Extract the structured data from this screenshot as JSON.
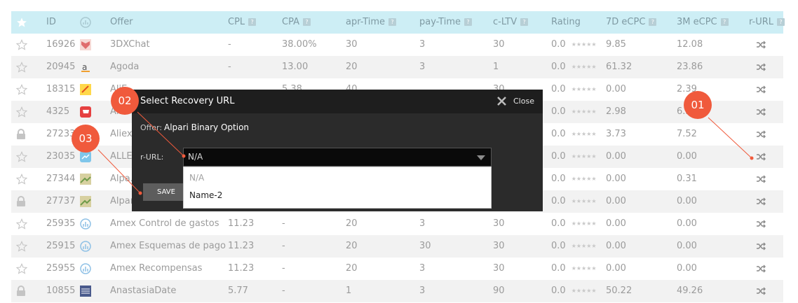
{
  "columns": {
    "id": "ID",
    "offer": "Offer",
    "cpl": "CPL",
    "cpa": "CPA",
    "apr_time": "apr-Time",
    "pay_time": "pay-Time",
    "c_ltv": "c-LTV",
    "rating": "Rating",
    "ecpc7d": "7D eCPC",
    "ecpc3m": "3M eCPC",
    "rurl": "r-URL",
    "help_glyph": "?"
  },
  "rating_stars": "★★★★★",
  "rows": [
    {
      "id": "16926",
      "offer": "3DXChat",
      "cpl": "-",
      "cpa": "38.00%",
      "apr": "30",
      "pay": "3",
      "ltv": "30",
      "rating": "0.0",
      "e7": "9.85",
      "e3": "12.08",
      "logo_icon": "anime-face-icon",
      "locked": false,
      "logo_text": ""
    },
    {
      "id": "20945",
      "offer": "Agoda",
      "cpl": "-",
      "cpa": "13.00",
      "apr": "20",
      "pay": "3",
      "ltv": "1",
      "rating": "0.0",
      "e7": "61.32",
      "e3": "23.86",
      "logo_icon": "agoda-logo-icon",
      "locked": false,
      "logo_text": "a"
    },
    {
      "id": "18315",
      "offer": "AliE...",
      "cpl": "",
      "cpa": "5.38",
      "apr": "40",
      "pay": "",
      "ltv": "30",
      "rating": "0.0",
      "e7": "0.00",
      "e3": "2.39",
      "logo_icon": "aliexpress-logo-icon",
      "locked": false,
      "logo_text": ""
    },
    {
      "id": "4325",
      "offer": "Al...",
      "cpl": "",
      "cpa": "",
      "apr": "",
      "pay": "",
      "ltv": "",
      "rating": "0.0",
      "e7": "2.98",
      "e3": "6.3",
      "logo_icon": "cart-logo-icon",
      "locked": false,
      "logo_text": ""
    },
    {
      "id": "27233",
      "offer": "Aliex...",
      "cpl": "",
      "cpa": "",
      "apr": "",
      "pay": "",
      "ltv": "",
      "rating": "0.0",
      "e7": "3.73",
      "e3": "7.52",
      "logo_icon": "",
      "locked": true,
      "logo_text": ""
    },
    {
      "id": "23035",
      "offer": "ALLE...",
      "cpl": "",
      "cpa": "",
      "apr": "",
      "pay": "",
      "ltv": "",
      "rating": "0.0",
      "e7": "0.00",
      "e3": "0.00",
      "logo_icon": "allegro-logo-icon",
      "locked": false,
      "logo_text": ""
    },
    {
      "id": "27344",
      "offer": "Alpa...",
      "cpl": "",
      "cpa": "",
      "apr": "",
      "pay": "",
      "ltv": "",
      "rating": "0.0",
      "e7": "0.00",
      "e3": "0.31",
      "logo_icon": "alpari-logo-icon",
      "locked": false,
      "logo_text": ""
    },
    {
      "id": "27737",
      "offer": "Alpar...",
      "cpl": "",
      "cpa": "",
      "apr": "",
      "pay": "",
      "ltv": "",
      "rating": "0.0",
      "e7": "0.00",
      "e3": "0.00",
      "logo_icon": "alpari-logo-icon",
      "locked": true,
      "logo_text": ""
    },
    {
      "id": "25935",
      "offer": "Amex Control de gastos",
      "cpl": "11.23",
      "cpa": "-",
      "apr": "20",
      "pay": "3",
      "ltv": "30",
      "rating": "0.0",
      "e7": "0.00",
      "e3": "0.00",
      "logo_icon": "wifi-logo-icon",
      "locked": false,
      "logo_text": ""
    },
    {
      "id": "25915",
      "offer": "Amex Esquemas de pago",
      "cpl": "11.23",
      "cpa": "-",
      "apr": "20",
      "pay": "30",
      "ltv": "30",
      "rating": "0.0",
      "e7": "0.00",
      "e3": "0.00",
      "logo_icon": "wifi-logo-icon",
      "locked": false,
      "logo_text": ""
    },
    {
      "id": "25955",
      "offer": "Amex Recompensas",
      "cpl": "11.23",
      "cpa": "-",
      "apr": "20",
      "pay": "3",
      "ltv": "30",
      "rating": "0.0",
      "e7": "0.00",
      "e3": "0.00",
      "logo_icon": "wifi-logo-icon",
      "locked": false,
      "logo_text": ""
    },
    {
      "id": "10855",
      "offer": "AnastasiaDate",
      "cpl": "5.77",
      "cpa": "-",
      "apr": "1",
      "pay": "3",
      "ltv": "90",
      "rating": "0.0",
      "e7": "50.22",
      "e3": "49.26",
      "logo_icon": "anastasia-logo-icon",
      "locked": true,
      "logo_text": ""
    }
  ],
  "modal": {
    "title": "Select Recovery URL",
    "close_label": "Close",
    "offer_label": "Offer:",
    "offer_value": "Alpari Binary Option",
    "rurl_label": "r-URL:",
    "select_value": "N/A",
    "options": [
      "N/A",
      "Name-2"
    ],
    "save_label": "SAVE"
  },
  "badges": [
    "01",
    "02",
    "03"
  ],
  "colors": {
    "header_bg": "#cdeef5",
    "accent": "#f05a3c",
    "modal_bg": "#2b2b2b"
  }
}
